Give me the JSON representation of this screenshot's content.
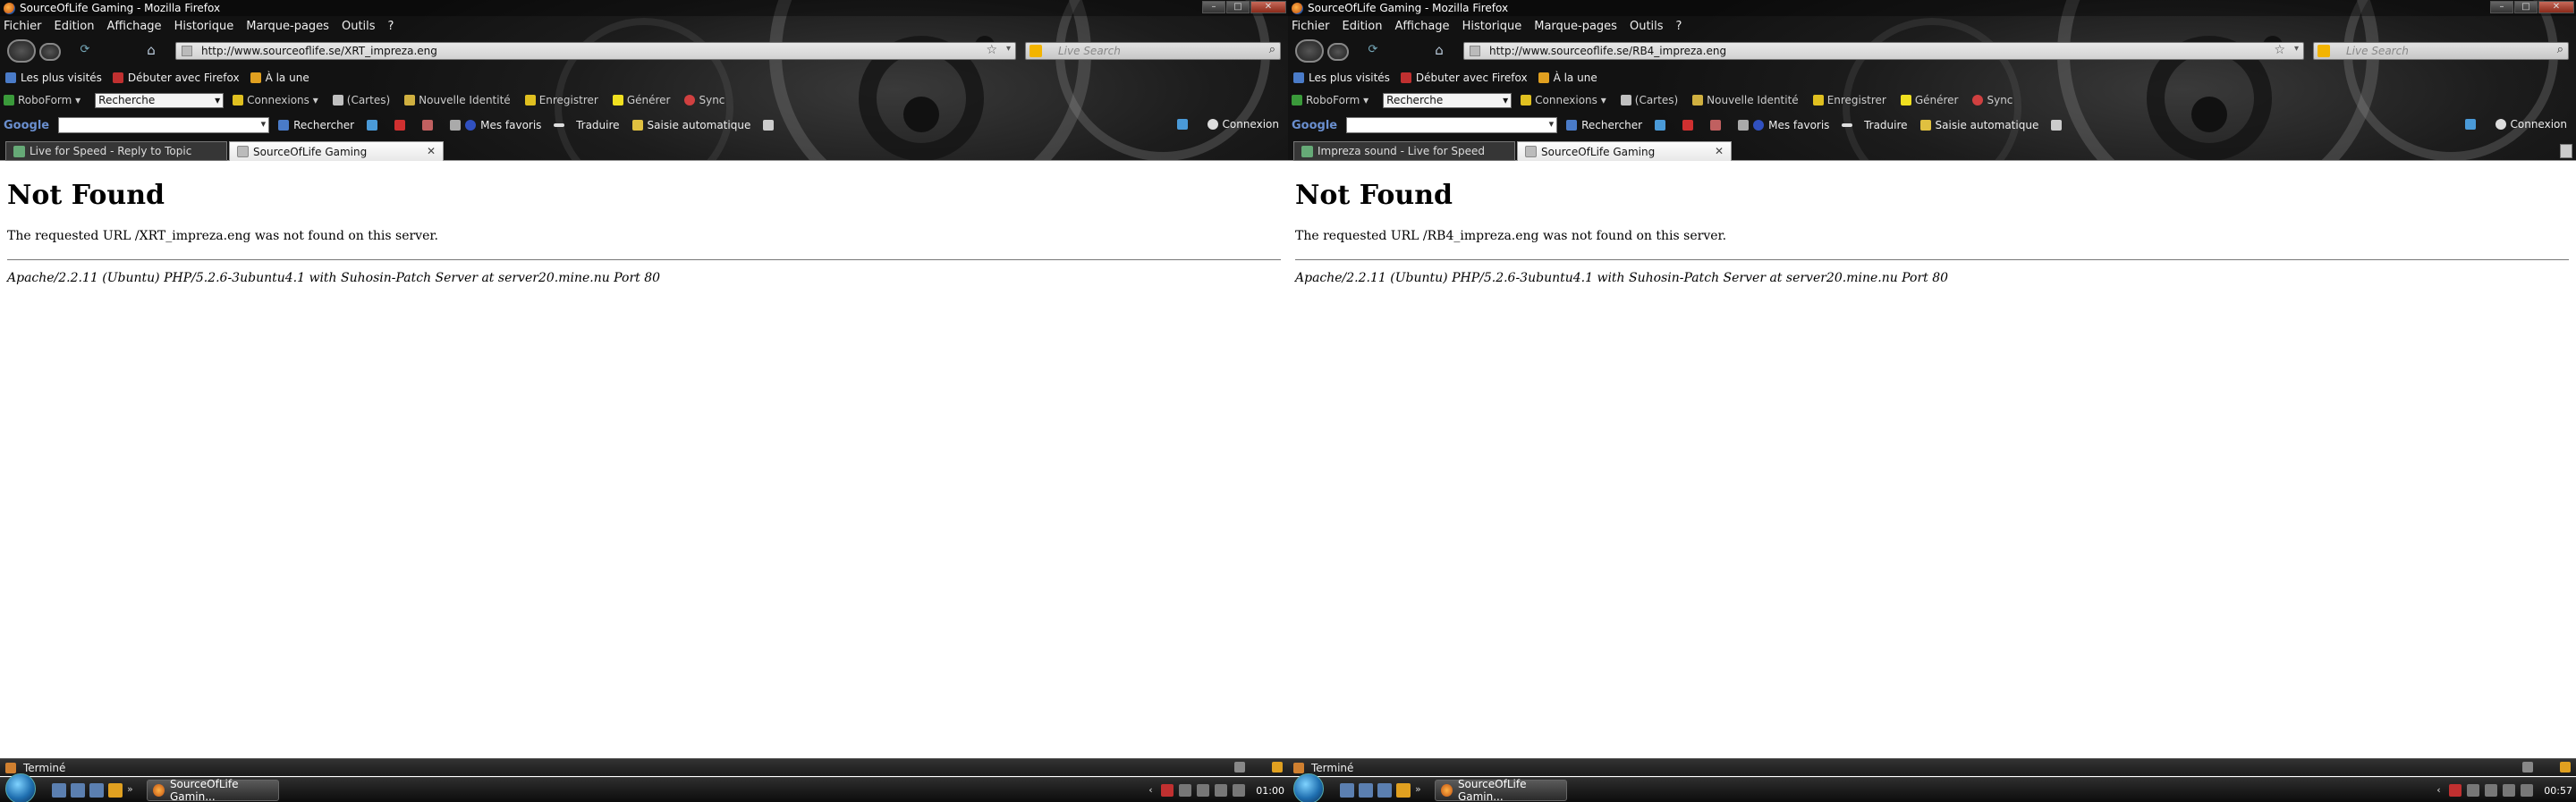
{
  "screens": [
    {
      "window_title": "SourceOfLife Gaming - Mozilla Firefox",
      "menu": [
        "Fichier",
        "Edition",
        "Affichage",
        "Historique",
        "Marque-pages",
        "Outils",
        "?"
      ],
      "url": "http://www.sourceoflife.se/XRT_impreza.eng",
      "search_placeholder": "Live Search",
      "bookmarks": [
        "Les plus visités",
        "Débuter avec Firefox",
        "À la une"
      ],
      "toolbar": {
        "roboform": "RoboForm",
        "search_select": "Recherche",
        "connexions": "Connexions",
        "cartes": "(Cartes)",
        "nouvelle_identite": "Nouvelle Identité",
        "enregistrer": "Enregistrer",
        "generer": "Générer",
        "sync": "Sync"
      },
      "google_toolbar": {
        "logo": "Google",
        "rechercher": "Rechercher",
        "favoris": "Mes favoris",
        "traduire": "Traduire",
        "saisie": "Saisie automatique",
        "connexion": "Connexion"
      },
      "tabs": [
        "Live for Speed - Reply to Topic",
        "SourceOfLife Gaming"
      ],
      "content": {
        "heading": "Not Found",
        "message": "The requested URL /XRT_impreza.eng was not found on this server.",
        "address": "Apache/2.2.11 (Ubuntu) PHP/5.2.6-3ubuntu4.1 with Suhosin-Patch Server at server20.mine.nu Port 80"
      },
      "status": "Terminé",
      "taskbar_item": "SourceOfLife Gamin...",
      "clock": "01:00"
    },
    {
      "window_title": "SourceOfLife Gaming - Mozilla Firefox",
      "menu": [
        "Fichier",
        "Edition",
        "Affichage",
        "Historique",
        "Marque-pages",
        "Outils",
        "?"
      ],
      "url": "http://www.sourceoflife.se/RB4_impreza.eng",
      "search_placeholder": "Live Search",
      "bookmarks": [
        "Les plus visités",
        "Débuter avec Firefox",
        "À la une"
      ],
      "toolbar": {
        "roboform": "RoboForm",
        "search_select": "Recherche",
        "connexions": "Connexions",
        "cartes": "(Cartes)",
        "nouvelle_identite": "Nouvelle Identité",
        "enregistrer": "Enregistrer",
        "generer": "Générer",
        "sync": "Sync"
      },
      "google_toolbar": {
        "logo": "Google",
        "rechercher": "Rechercher",
        "favoris": "Mes favoris",
        "traduire": "Traduire",
        "saisie": "Saisie automatique",
        "connexion": "Connexion"
      },
      "tabs": [
        "Impreza sound - Live for Speed",
        "SourceOfLife Gaming"
      ],
      "content": {
        "heading": "Not Found",
        "message": "The requested URL /RB4_impreza.eng was not found on this server.",
        "address": "Apache/2.2.11 (Ubuntu) PHP/5.2.6-3ubuntu4.1 with Suhosin-Patch Server at server20.mine.nu Port 80"
      },
      "status": "Terminé",
      "taskbar_item": "SourceOfLife Gamin...",
      "clock": "00:57"
    }
  ]
}
